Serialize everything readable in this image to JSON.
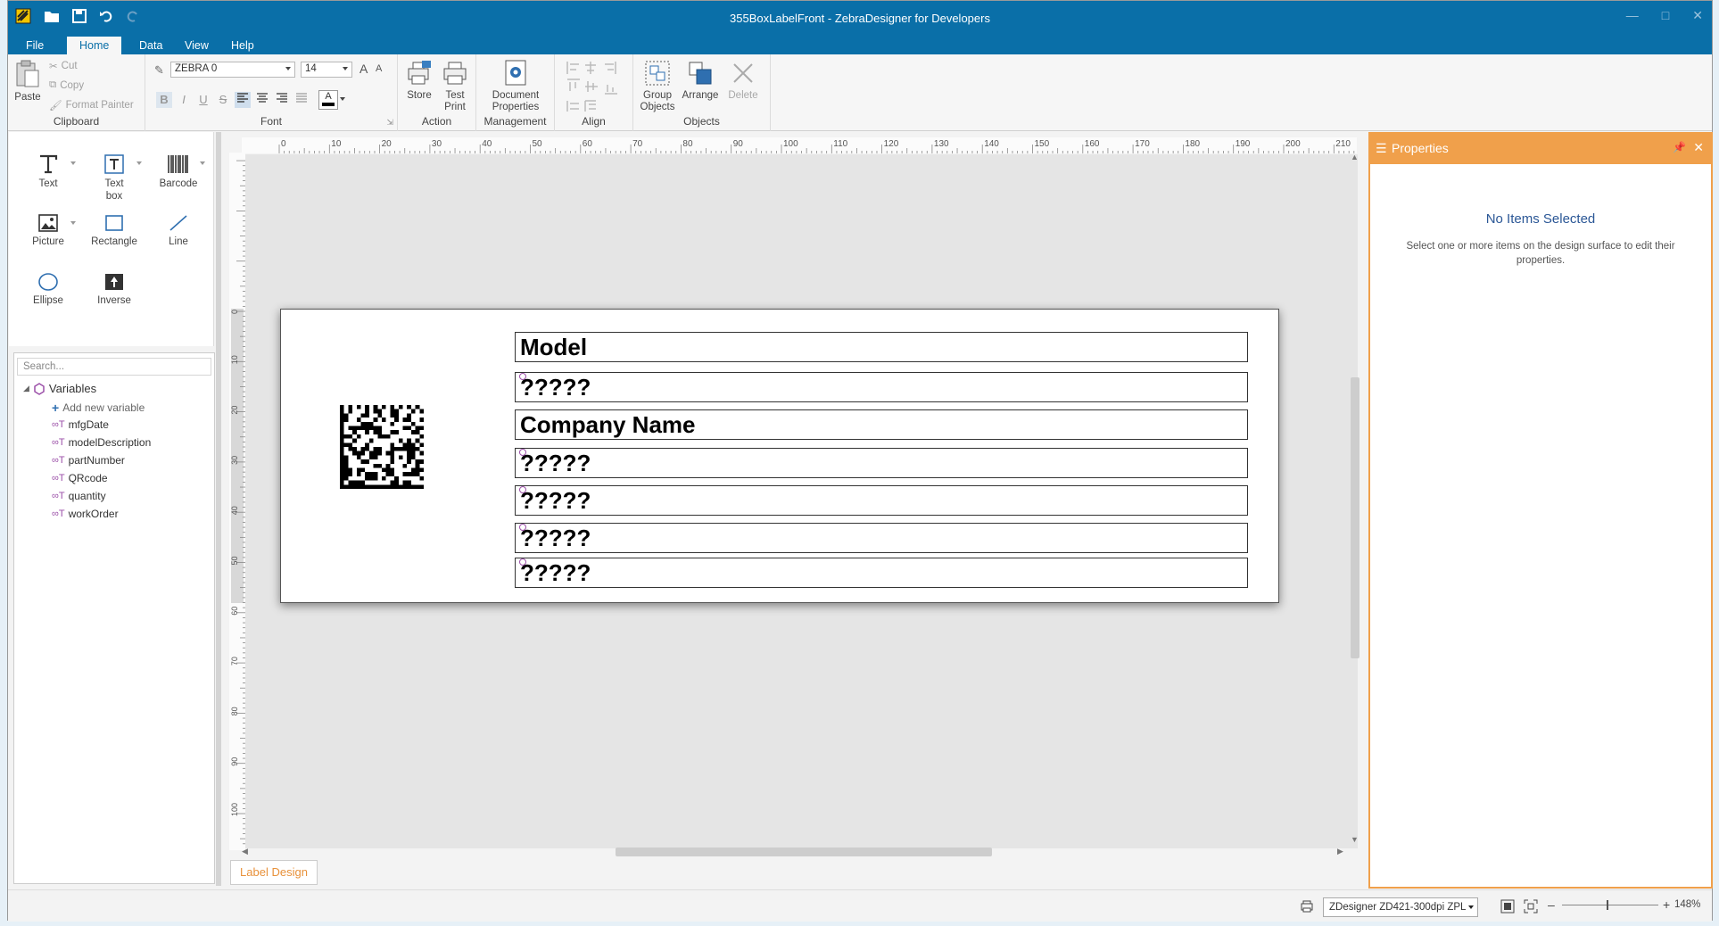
{
  "window": {
    "title": "355BoxLabelFront - ZebraDesigner for Developers"
  },
  "menu": {
    "tabs": [
      "File",
      "Home",
      "Data",
      "View",
      "Help"
    ],
    "active": "Home"
  },
  "ribbon": {
    "clipboard": {
      "paste": "Paste",
      "cut": "Cut",
      "copy": "Copy",
      "format_painter": "Format Painter",
      "label": "Clipboard"
    },
    "font": {
      "family": "ZEBRA 0",
      "size": "14",
      "label": "Font",
      "bold": "B",
      "italic": "I",
      "underline": "U",
      "strike": "S",
      "grow": "A",
      "shrink": "A",
      "color": "A"
    },
    "action": {
      "store": "Store",
      "test": "Test",
      "print": "Print",
      "label": "Action"
    },
    "management": {
      "doc1": "Document",
      "doc2": "Properties",
      "label": "Management"
    },
    "align": {
      "label": "Align"
    },
    "objects": {
      "group1": "Group",
      "group2": "Objects",
      "arrange": "Arrange",
      "delete": "Delete",
      "label": "Objects"
    }
  },
  "toolbox": {
    "text": "Text",
    "textbox1": "Text",
    "textbox2": "box",
    "barcode": "Barcode",
    "picture": "Picture",
    "rectangle": "Rectangle",
    "line": "Line",
    "ellipse": "Ellipse",
    "inverse": "Inverse"
  },
  "variables": {
    "search_placeholder": "Search...",
    "root": "Variables",
    "add": "Add new variable",
    "items": [
      "mfgDate",
      "modelDescription",
      "partNumber",
      "QRcode",
      "quantity",
      "workOrder"
    ]
  },
  "ruler": {
    "h_ticks": [
      "0",
      "10",
      "20",
      "30",
      "40",
      "50",
      "60",
      "70",
      "80",
      "90",
      "100",
      "110",
      "120",
      "130",
      "140",
      "150",
      "160",
      "170",
      "180",
      "190",
      "200",
      "210"
    ],
    "v_ticks": [
      "0",
      "10",
      "20",
      "30",
      "40",
      "50",
      "60",
      "70",
      "80",
      "90",
      "100"
    ]
  },
  "label": {
    "fields": [
      "Model",
      "?????",
      "Company Name",
      "?????",
      "?????",
      "?????",
      "?????"
    ]
  },
  "tabs": {
    "label_design": "Label Design"
  },
  "properties": {
    "title": "Properties",
    "empty_title": "No Items Selected",
    "empty_desc": "Select one or more items on the design surface to edit their properties."
  },
  "status": {
    "printer": "ZDesigner ZD421-300dpi ZPL",
    "zoom": "148%"
  },
  "colors": {
    "title_bar": "#0a6fa8",
    "accent": "#f0a04b"
  }
}
